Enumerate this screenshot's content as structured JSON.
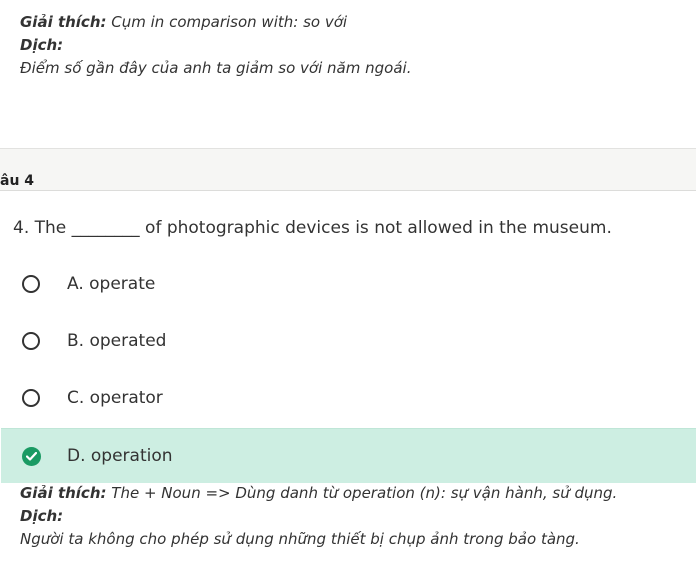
{
  "previous_explanation": {
    "explain_label": "Giải thích:",
    "explain_text": "Cụm in comparison with: so với",
    "translate_label": "Dịch:",
    "translate_text": "Điểm số gần đây của anh ta giảm so với năm ngoái."
  },
  "question": {
    "header": "âu 4",
    "text": "4. The ________ of photographic devices is not allowed in the museum.",
    "options": [
      {
        "label": "A. operate",
        "selected": false
      },
      {
        "label": "B. operated",
        "selected": false
      },
      {
        "label": "C. operator",
        "selected": false
      },
      {
        "label": "D. operation",
        "selected": true
      }
    ],
    "explanation": {
      "explain_label": "Giải thích:",
      "explain_text": "The + Noun => Dùng danh từ operation (n): sự vận hành, sử dụng.",
      "translate_label": "Dịch:",
      "translate_text": "Người ta không cho phép sử dụng những thiết bị chụp ảnh trong bảo tàng."
    }
  },
  "colors": {
    "selected_background": "#cdeee2",
    "check_icon": "#1a9a63",
    "header_background": "#f6f6f4"
  },
  "icons": {
    "unselected": "radio-empty-icon",
    "selected": "check-circle-icon"
  }
}
